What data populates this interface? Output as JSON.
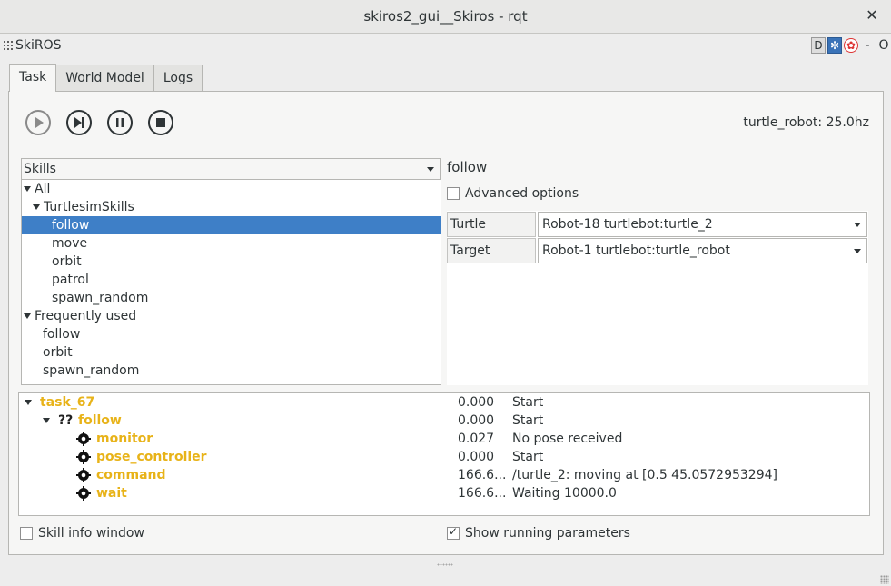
{
  "window": {
    "title": "skiros2_gui__Skiros - rqt",
    "close_glyph": "✕"
  },
  "plugin": {
    "name": "SkiROS",
    "icons": [
      "D",
      "settings-icon",
      "help-icon"
    ],
    "minimize": "-",
    "float": "O"
  },
  "tabs": [
    {
      "label": "Task",
      "active": true
    },
    {
      "label": "World Model"
    },
    {
      "label": "Logs"
    }
  ],
  "controls": {
    "buttons": [
      "play-icon",
      "step-icon",
      "pause-icon",
      "stop-icon"
    ],
    "rate": "turtle_robot: 25.0hz"
  },
  "skills_combo": {
    "selected": "Skills"
  },
  "skill_tree": [
    {
      "label": "All",
      "level": 0,
      "expanded": true
    },
    {
      "label": "TurtlesimSkills",
      "level": 1,
      "expanded": true
    },
    {
      "label": "follow",
      "level": 2,
      "selected": true
    },
    {
      "label": "move",
      "level": 2
    },
    {
      "label": "orbit",
      "level": 2
    },
    {
      "label": "patrol",
      "level": 2
    },
    {
      "label": "spawn_random",
      "level": 2
    },
    {
      "label": "Frequently used",
      "level": 0,
      "expanded": true
    },
    {
      "label": "follow",
      "level": 1
    },
    {
      "label": "orbit",
      "level": 1
    },
    {
      "label": "spawn_random",
      "level": 1
    }
  ],
  "skill_detail": {
    "title": "follow",
    "advanced_label": "Advanced options",
    "params": [
      {
        "label": "Turtle",
        "value": "Robot-18 turtlebot:turtle_2"
      },
      {
        "label": "Target",
        "value": "Robot-1 turtlebot:turtle_robot"
      }
    ]
  },
  "task_tree": [
    {
      "name": "task_67",
      "level": 0,
      "value": "0.000",
      "message": "Start"
    },
    {
      "name": "follow",
      "level": 1,
      "prefix": "??",
      "value": "0.000",
      "message": "Start"
    },
    {
      "name": "monitor",
      "level": 2,
      "value": "0.027",
      "message": "No pose received"
    },
    {
      "name": "pose_controller",
      "level": 2,
      "value": "0.000",
      "message": "Start"
    },
    {
      "name": "command",
      "level": 2,
      "value": "166.6...",
      "message": "/turtle_2: moving at [0.5 45.0572953294]"
    },
    {
      "name": "wait",
      "level": 2,
      "value": "166.6...",
      "message": "Waiting 10000.0"
    }
  ],
  "bottom": {
    "skill_info_label": "Skill info window",
    "skill_info_checked": false,
    "show_params_label": "Show running parameters",
    "show_params_checked": true
  },
  "colors": {
    "selection": "#3e7fc7",
    "task_name": "#e8b319"
  }
}
